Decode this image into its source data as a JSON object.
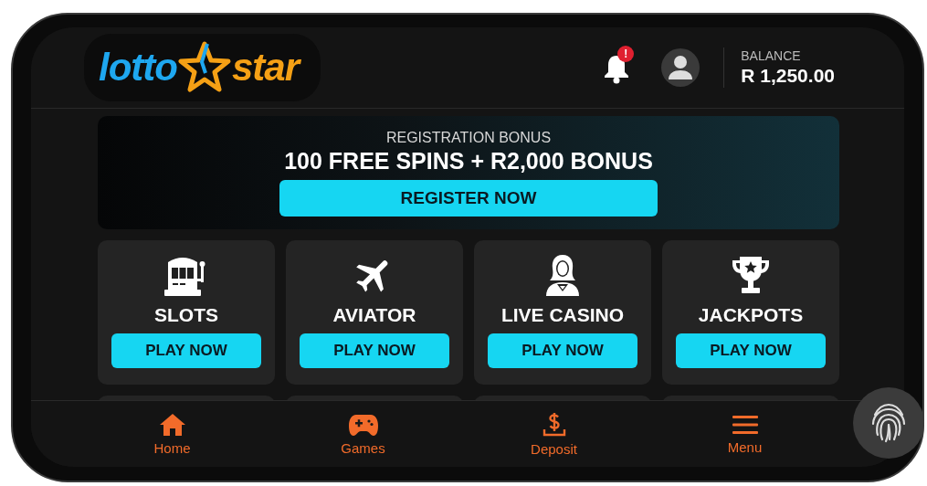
{
  "header": {
    "logo": {
      "left": "lotto",
      "right": "star"
    },
    "notification_badge": "!",
    "balance": {
      "label": "BALANCE",
      "amount": "R 1,250.00"
    }
  },
  "banner": {
    "eyebrow": "REGISTRATION BONUS",
    "headline": "100 FREE SPINS + R2,000 BONUS",
    "button": "REGISTER NOW"
  },
  "games": [
    {
      "kind": "slots",
      "title": "SLOTS",
      "button": "PLAY NOW"
    },
    {
      "kind": "aviator",
      "title": "AVIATOR",
      "button": "PLAY NOW"
    },
    {
      "kind": "live",
      "title": "LIVE CASINO",
      "button": "PLAY NOW"
    },
    {
      "kind": "jackpots",
      "title": "JACKPOTS",
      "button": "PLAY NOW"
    }
  ],
  "bottom_nav": [
    {
      "kind": "home",
      "label": "Home"
    },
    {
      "kind": "games",
      "label": "Games"
    },
    {
      "kind": "deposit",
      "label": "Deposit"
    },
    {
      "kind": "menu",
      "label": "Menu"
    }
  ]
}
